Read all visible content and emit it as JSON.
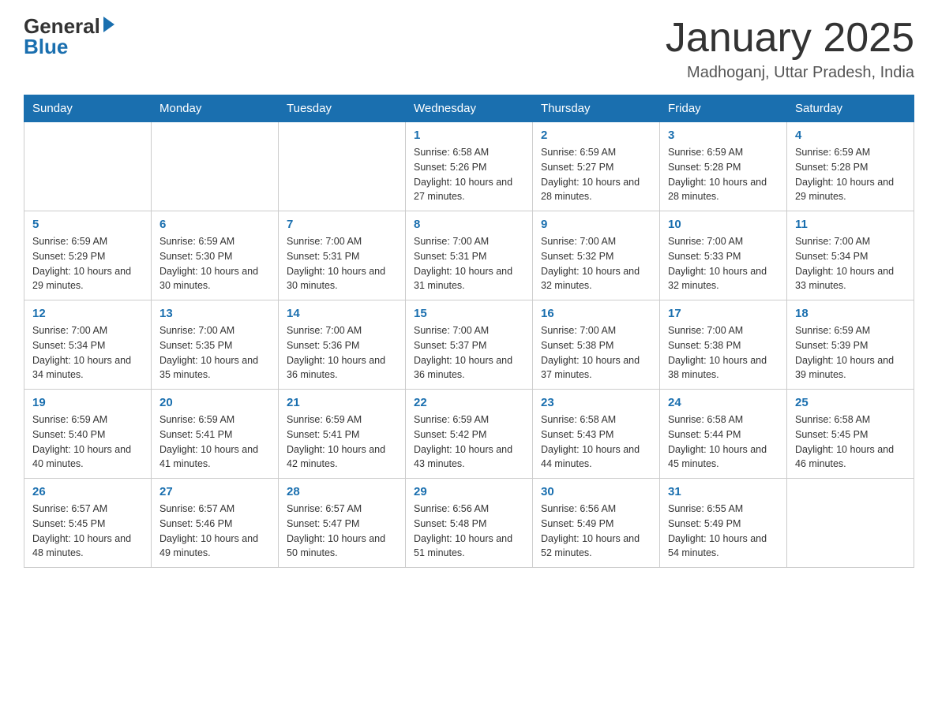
{
  "header": {
    "logo_general": "General",
    "logo_blue": "Blue",
    "month_title": "January 2025",
    "location": "Madhoganj, Uttar Pradesh, India"
  },
  "days_of_week": [
    "Sunday",
    "Monday",
    "Tuesday",
    "Wednesday",
    "Thursday",
    "Friday",
    "Saturday"
  ],
  "weeks": [
    [
      {
        "day": "",
        "sunrise": "",
        "sunset": "",
        "daylight": ""
      },
      {
        "day": "",
        "sunrise": "",
        "sunset": "",
        "daylight": ""
      },
      {
        "day": "",
        "sunrise": "",
        "sunset": "",
        "daylight": ""
      },
      {
        "day": "1",
        "sunrise": "Sunrise: 6:58 AM",
        "sunset": "Sunset: 5:26 PM",
        "daylight": "Daylight: 10 hours and 27 minutes."
      },
      {
        "day": "2",
        "sunrise": "Sunrise: 6:59 AM",
        "sunset": "Sunset: 5:27 PM",
        "daylight": "Daylight: 10 hours and 28 minutes."
      },
      {
        "day": "3",
        "sunrise": "Sunrise: 6:59 AM",
        "sunset": "Sunset: 5:28 PM",
        "daylight": "Daylight: 10 hours and 28 minutes."
      },
      {
        "day": "4",
        "sunrise": "Sunrise: 6:59 AM",
        "sunset": "Sunset: 5:28 PM",
        "daylight": "Daylight: 10 hours and 29 minutes."
      }
    ],
    [
      {
        "day": "5",
        "sunrise": "Sunrise: 6:59 AM",
        "sunset": "Sunset: 5:29 PM",
        "daylight": "Daylight: 10 hours and 29 minutes."
      },
      {
        "day": "6",
        "sunrise": "Sunrise: 6:59 AM",
        "sunset": "Sunset: 5:30 PM",
        "daylight": "Daylight: 10 hours and 30 minutes."
      },
      {
        "day": "7",
        "sunrise": "Sunrise: 7:00 AM",
        "sunset": "Sunset: 5:31 PM",
        "daylight": "Daylight: 10 hours and 30 minutes."
      },
      {
        "day": "8",
        "sunrise": "Sunrise: 7:00 AM",
        "sunset": "Sunset: 5:31 PM",
        "daylight": "Daylight: 10 hours and 31 minutes."
      },
      {
        "day": "9",
        "sunrise": "Sunrise: 7:00 AM",
        "sunset": "Sunset: 5:32 PM",
        "daylight": "Daylight: 10 hours and 32 minutes."
      },
      {
        "day": "10",
        "sunrise": "Sunrise: 7:00 AM",
        "sunset": "Sunset: 5:33 PM",
        "daylight": "Daylight: 10 hours and 32 minutes."
      },
      {
        "day": "11",
        "sunrise": "Sunrise: 7:00 AM",
        "sunset": "Sunset: 5:34 PM",
        "daylight": "Daylight: 10 hours and 33 minutes."
      }
    ],
    [
      {
        "day": "12",
        "sunrise": "Sunrise: 7:00 AM",
        "sunset": "Sunset: 5:34 PM",
        "daylight": "Daylight: 10 hours and 34 minutes."
      },
      {
        "day": "13",
        "sunrise": "Sunrise: 7:00 AM",
        "sunset": "Sunset: 5:35 PM",
        "daylight": "Daylight: 10 hours and 35 minutes."
      },
      {
        "day": "14",
        "sunrise": "Sunrise: 7:00 AM",
        "sunset": "Sunset: 5:36 PM",
        "daylight": "Daylight: 10 hours and 36 minutes."
      },
      {
        "day": "15",
        "sunrise": "Sunrise: 7:00 AM",
        "sunset": "Sunset: 5:37 PM",
        "daylight": "Daylight: 10 hours and 36 minutes."
      },
      {
        "day": "16",
        "sunrise": "Sunrise: 7:00 AM",
        "sunset": "Sunset: 5:38 PM",
        "daylight": "Daylight: 10 hours and 37 minutes."
      },
      {
        "day": "17",
        "sunrise": "Sunrise: 7:00 AM",
        "sunset": "Sunset: 5:38 PM",
        "daylight": "Daylight: 10 hours and 38 minutes."
      },
      {
        "day": "18",
        "sunrise": "Sunrise: 6:59 AM",
        "sunset": "Sunset: 5:39 PM",
        "daylight": "Daylight: 10 hours and 39 minutes."
      }
    ],
    [
      {
        "day": "19",
        "sunrise": "Sunrise: 6:59 AM",
        "sunset": "Sunset: 5:40 PM",
        "daylight": "Daylight: 10 hours and 40 minutes."
      },
      {
        "day": "20",
        "sunrise": "Sunrise: 6:59 AM",
        "sunset": "Sunset: 5:41 PM",
        "daylight": "Daylight: 10 hours and 41 minutes."
      },
      {
        "day": "21",
        "sunrise": "Sunrise: 6:59 AM",
        "sunset": "Sunset: 5:41 PM",
        "daylight": "Daylight: 10 hours and 42 minutes."
      },
      {
        "day": "22",
        "sunrise": "Sunrise: 6:59 AM",
        "sunset": "Sunset: 5:42 PM",
        "daylight": "Daylight: 10 hours and 43 minutes."
      },
      {
        "day": "23",
        "sunrise": "Sunrise: 6:58 AM",
        "sunset": "Sunset: 5:43 PM",
        "daylight": "Daylight: 10 hours and 44 minutes."
      },
      {
        "day": "24",
        "sunrise": "Sunrise: 6:58 AM",
        "sunset": "Sunset: 5:44 PM",
        "daylight": "Daylight: 10 hours and 45 minutes."
      },
      {
        "day": "25",
        "sunrise": "Sunrise: 6:58 AM",
        "sunset": "Sunset: 5:45 PM",
        "daylight": "Daylight: 10 hours and 46 minutes."
      }
    ],
    [
      {
        "day": "26",
        "sunrise": "Sunrise: 6:57 AM",
        "sunset": "Sunset: 5:45 PM",
        "daylight": "Daylight: 10 hours and 48 minutes."
      },
      {
        "day": "27",
        "sunrise": "Sunrise: 6:57 AM",
        "sunset": "Sunset: 5:46 PM",
        "daylight": "Daylight: 10 hours and 49 minutes."
      },
      {
        "day": "28",
        "sunrise": "Sunrise: 6:57 AM",
        "sunset": "Sunset: 5:47 PM",
        "daylight": "Daylight: 10 hours and 50 minutes."
      },
      {
        "day": "29",
        "sunrise": "Sunrise: 6:56 AM",
        "sunset": "Sunset: 5:48 PM",
        "daylight": "Daylight: 10 hours and 51 minutes."
      },
      {
        "day": "30",
        "sunrise": "Sunrise: 6:56 AM",
        "sunset": "Sunset: 5:49 PM",
        "daylight": "Daylight: 10 hours and 52 minutes."
      },
      {
        "day": "31",
        "sunrise": "Sunrise: 6:55 AM",
        "sunset": "Sunset: 5:49 PM",
        "daylight": "Daylight: 10 hours and 54 minutes."
      },
      {
        "day": "",
        "sunrise": "",
        "sunset": "",
        "daylight": ""
      }
    ]
  ]
}
